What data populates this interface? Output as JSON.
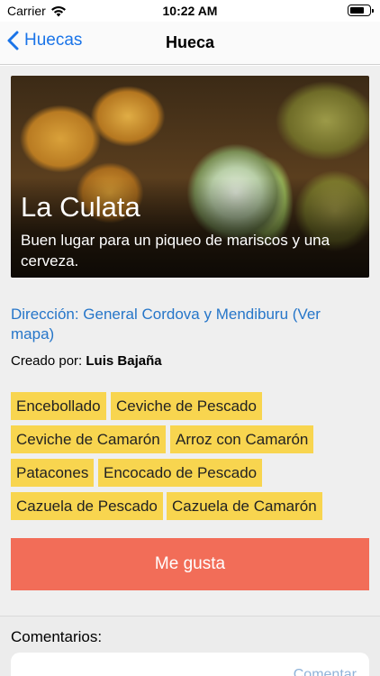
{
  "status_bar": {
    "carrier": "Carrier",
    "time": "10:22 AM"
  },
  "nav": {
    "back_label": "Huecas",
    "title": "Hueca"
  },
  "place": {
    "name": "La Culata",
    "description": "Buen lugar para un piqueo de mariscos y una cerveza.",
    "address": "Dirección: General Cordova y Mendiburu (Ver mapa)",
    "creator_label": "Creado por:",
    "creator_name": "Luis Bajaña"
  },
  "dishes": [
    "Encebollado",
    "Ceviche de Pescado",
    "Ceviche de Camarón",
    "Arroz con Camarón",
    "Patacones",
    "Encocado de Pescado",
    "Cazuela de Pescado",
    "Cazuela de Camarón"
  ],
  "like_button": {
    "label": "Me gusta",
    "color": "#f26d58"
  },
  "comments": {
    "label": "Comentarios:",
    "submit_label": "Comentar"
  },
  "colors": {
    "accent": "#1a74e8",
    "tag": "#f8d54f"
  }
}
